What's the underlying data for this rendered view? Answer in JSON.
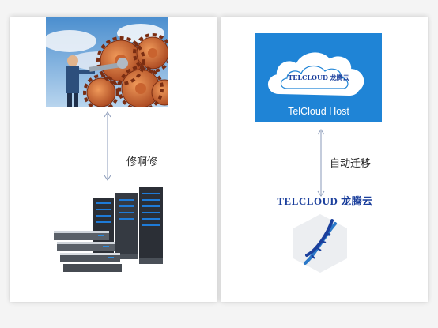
{
  "left_panel": {
    "label": "修啊修"
  },
  "right_panel": {
    "host_card_label": "TelCloud Host",
    "cloud_logo_text": "TELCLOUD 龙腾云",
    "label": "自动迁移",
    "brand_text": "TELCLOUD 龙腾云"
  },
  "colors": {
    "card_blue": "#1f84d6",
    "brand_blue": "#1b3f9c",
    "arrow": "#8a9ab8"
  },
  "icons": {
    "gear_illustration": "wrench-gears-icon",
    "server_illustration": "server-rack-icon",
    "cloud": "cloud-icon",
    "dna": "dna-icon"
  }
}
